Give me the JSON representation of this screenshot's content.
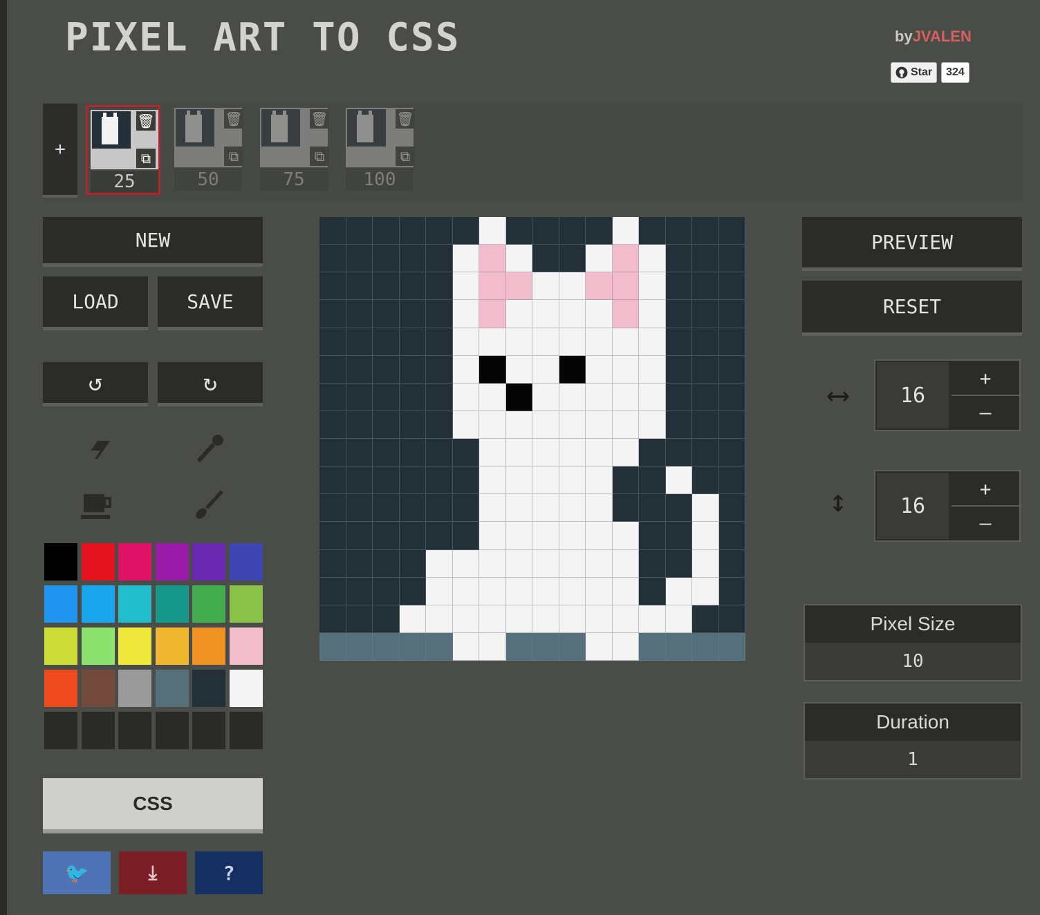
{
  "app": {
    "title": "PIXEL ART TO CSS",
    "byline_prefix": "by",
    "author": "JVALEN",
    "github_star_label": "Star",
    "github_star_count": "324"
  },
  "frames": {
    "add_label": "+",
    "items": [
      {
        "percent": "25",
        "active": true
      },
      {
        "percent": "50",
        "active": false
      },
      {
        "percent": "75",
        "active": false
      },
      {
        "percent": "100",
        "active": false
      }
    ]
  },
  "left_panel": {
    "new_label": "NEW",
    "load_label": "LOAD",
    "save_label": "SAVE",
    "undo_icon": "undo-icon",
    "redo_icon": "redo-icon",
    "tools": [
      "eraser-icon",
      "eyedropper-icon",
      "bucket-icon",
      "brush-icon"
    ],
    "css_label": "CSS"
  },
  "palette": {
    "colors": [
      "#000000",
      "#e5121f",
      "#e01268",
      "#9b1ba9",
      "#6a27b1",
      "#3f46b4",
      "#2196f0",
      "#1ba5ef",
      "#21bdcd",
      "#16998a",
      "#43ad4d",
      "#8bc34a",
      "#cddc39",
      "#8ce26c",
      "#f0e83b",
      "#f2b730",
      "#f09124",
      "#f2bccc",
      "#f04a1f",
      "#724b3d",
      "#9a9a9a",
      "#56707b",
      "#233038",
      "#f5f5f5",
      "#2a2a28",
      "#2a2a28",
      "#2a2a28",
      "#2a2a28",
      "#2a2a28",
      "#2a2a28"
    ]
  },
  "canvas": {
    "columns": 16,
    "rows": 16,
    "colors": {
      "B": "#233038",
      "W": "#f4f4f4",
      "P": "#f2bccc",
      "K": "#050505",
      "G": "#56707b"
    },
    "pixels": [
      "BBBBBBWBBBBWBBBB",
      "BBBBBWPWBBWPWBBB",
      "BBBBBWPPWWPPWBBB",
      "BBBBBWPWWWWPWBBB",
      "BBBBBWWWWWWWWBBB",
      "BBBBBWKWWKWWWBBB",
      "BBBBBWWKWWWWWBBB",
      "BBBBBWWWWWWWWBBB",
      "BBBBBBWWWWWWBBBB",
      "BBBBBBWWWWWBBWBB",
      "BBBBBBWWWWWBBBWB",
      "BBBBBBWWWWWWBBWB",
      "BBBBWWWWWWWWBBWB",
      "BBBBWWWWWWWWBWWB",
      "BBBWWWWWWWWWWWBB",
      "GGGGGWWGGGWWGGGG"
    ]
  },
  "right_panel": {
    "preview_label": "PREVIEW",
    "reset_label": "RESET",
    "width_icon": "horizontal-arrows-icon",
    "height_icon": "vertical-arrows-icon",
    "columns_value": "16",
    "rows_value": "16",
    "plus": "+",
    "minus": "–",
    "pixel_size_label": "Pixel Size",
    "pixel_size_value": "10",
    "duration_label": "Duration",
    "duration_value": "1"
  },
  "share": {
    "twitter_icon": "twitter-icon",
    "download_icon": "download-icon",
    "help_label": "?"
  }
}
